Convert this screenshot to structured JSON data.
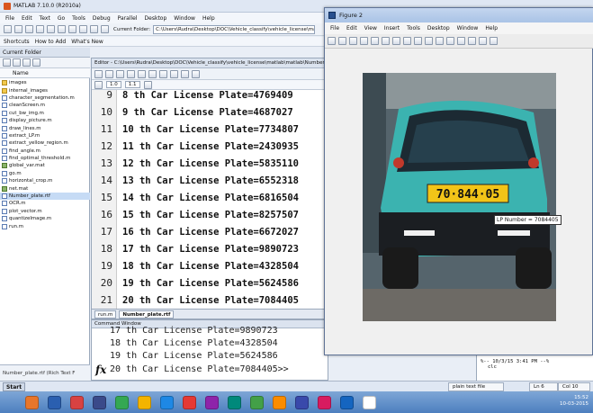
{
  "matlab": {
    "title": "MATLAB 7.10.0 (R2010a)",
    "menu": [
      "File",
      "Edit",
      "Text",
      "Go",
      "Tools",
      "Debug",
      "Parallel",
      "Desktop",
      "Window",
      "Help"
    ],
    "current_folder_label": "Current Folder:",
    "current_folder_path": "C:\\Users\\Rudra\\Desktop\\DOC\\Vehicle_classify\\vehicle_license\\mat",
    "shortcuts": [
      "Shortcuts",
      "How to Add",
      "What's New"
    ]
  },
  "folder_panel": {
    "title": "Current Folder",
    "column_name": "Name",
    "files": [
      {
        "name": "images",
        "type": "folder"
      },
      {
        "name": "internal_images",
        "type": "folder"
      },
      {
        "name": "character_segmentation.m",
        "type": "m"
      },
      {
        "name": "cleanScreen.m",
        "type": "m"
      },
      {
        "name": "cut_bw_img.m",
        "type": "m"
      },
      {
        "name": "display_picture.m",
        "type": "m"
      },
      {
        "name": "draw_lines.m",
        "type": "m"
      },
      {
        "name": "extract_LP.m",
        "type": "m"
      },
      {
        "name": "extract_yellow_region.m",
        "type": "m"
      },
      {
        "name": "find_angle.m",
        "type": "m"
      },
      {
        "name": "find_optimal_threshold.m",
        "type": "m"
      },
      {
        "name": "global_var.mat",
        "type": "mat"
      },
      {
        "name": "go.m",
        "type": "m"
      },
      {
        "name": "horizontal_crop.m",
        "type": "m"
      },
      {
        "name": "net.mat",
        "type": "mat"
      },
      {
        "name": "Number_plate.rtf",
        "type": "rtf",
        "selected": true
      },
      {
        "name": "OCR.m",
        "type": "m"
      },
      {
        "name": "plot_vector.m",
        "type": "m"
      },
      {
        "name": "quantizeImage.m",
        "type": "m"
      },
      {
        "name": "run.m",
        "type": "m"
      }
    ],
    "status": "Number_plate.rtf (Rich Text F"
  },
  "editor": {
    "title": "Editor - C:\\Users\\Rudra\\Desktop\\DOC\\Vehicle_classify\\vehicle_license\\matlab\\matlab\\Number_pl",
    "zoom_value": "1.0",
    "step_value": "1.1",
    "lines": [
      {
        "num": "9",
        "text": "8 th Car License Plate=4769409"
      },
      {
        "num": "10",
        "text": "9 th Car License Plate=4687027"
      },
      {
        "num": "11",
        "text": "10 th Car License Plate=7734807"
      },
      {
        "num": "12",
        "text": "11 th Car License Plate=2430935"
      },
      {
        "num": "13",
        "text": "12 th Car License Plate=5835110"
      },
      {
        "num": "14",
        "text": "13 th Car License Plate=6552318"
      },
      {
        "num": "15",
        "text": "14 th Car License Plate=6816504"
      },
      {
        "num": "16",
        "text": "15 th Car License Plate=8257507"
      },
      {
        "num": "17",
        "text": "16 th Car License Plate=6672027"
      },
      {
        "num": "18",
        "text": "17 th Car License Plate=9890723"
      },
      {
        "num": "19",
        "text": "18 th Car License Plate=4328504"
      },
      {
        "num": "20",
        "text": "19 th Car License Plate=5624586"
      },
      {
        "num": "21",
        "text": "20 th Car License Plate=7084405"
      }
    ],
    "tabs": [
      "run.m",
      "Number_plate.rtf"
    ]
  },
  "command_window": {
    "title": "Command Window",
    "lines": [
      "17 th Car License Plate=9890723",
      "18 th Car License Plate=4328504",
      "19 th Car License Plate=5624586",
      "20 th Car License Plate=7084405>>"
    ],
    "fx_label": "fx"
  },
  "history": {
    "lines": [
      "%-- 10/3/15  3:41 PM --%",
      "clc"
    ]
  },
  "statusbar": {
    "start": "Start",
    "file_type": "plain text file",
    "ln": "Ln  6",
    "col": "Col  10"
  },
  "tray": {
    "time": "15:52",
    "date": "10-03-2015"
  },
  "figure": {
    "title": "Figure 2",
    "menu": [
      "File",
      "Edit",
      "View",
      "Insert",
      "Tools",
      "Desktop",
      "Window",
      "Help"
    ],
    "plate_text": "70·844·05",
    "annotation": "LP Number = 7084405"
  }
}
